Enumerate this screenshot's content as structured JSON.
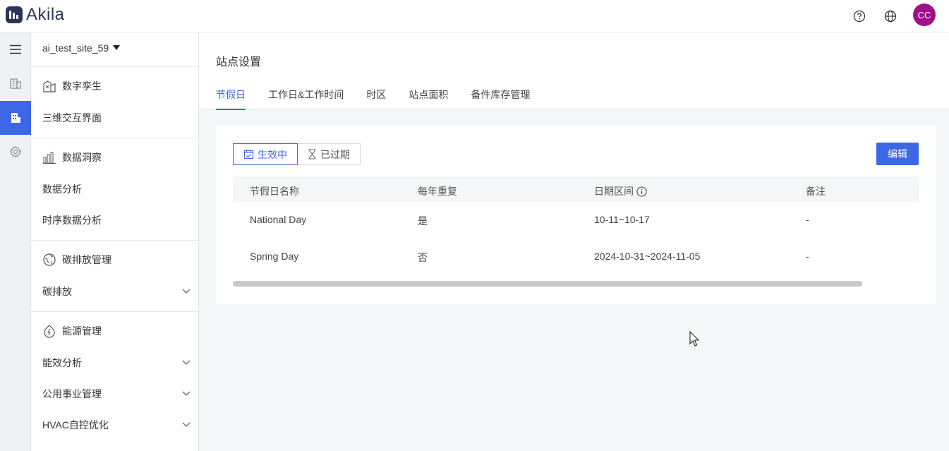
{
  "brand": {
    "name": "Akila"
  },
  "header": {
    "avatar_initials": "CC",
    "help_icon": "question-circle-icon",
    "lang_icon": "globe-icon"
  },
  "rail": {
    "items": [
      "menu-icon",
      "building-icon",
      "site-icon",
      "gear-icon"
    ],
    "active_index": 2
  },
  "sidenav": {
    "site": "ai_test_site_59",
    "groups": [
      {
        "label": "数字孪生",
        "icon": "digital-twin-icon",
        "items": [
          {
            "label": "三维交互界面",
            "expandable": false
          }
        ]
      },
      {
        "label": "数据洞察",
        "icon": "bar-chart-icon",
        "items": [
          {
            "label": "数据分析",
            "expandable": false
          },
          {
            "label": "时序数据分析",
            "expandable": false
          }
        ]
      },
      {
        "label": "碳排放管理",
        "icon": "globe-leaf-icon",
        "items": [
          {
            "label": "碳排放",
            "expandable": true
          }
        ]
      },
      {
        "label": "能源管理",
        "icon": "energy-icon",
        "items": [
          {
            "label": "能效分析",
            "expandable": true
          },
          {
            "label": "公用事业管理",
            "expandable": true
          },
          {
            "label": "HVAC自控优化",
            "expandable": true
          }
        ]
      }
    ]
  },
  "main": {
    "title": "站点设置",
    "tabs": [
      "节假日",
      "工作日&工作时间",
      "时区",
      "站点面积",
      "备件库存管理"
    ],
    "active_tab": 0,
    "filter": {
      "active": "生效中",
      "expired": "已过期"
    },
    "edit_label": "编辑",
    "table": {
      "headers": [
        "节假日名称",
        "每年重复",
        "日期区间",
        "备注"
      ],
      "rows": [
        [
          "National Day",
          "是",
          "10-11~10-17",
          "-"
        ],
        [
          "Spring Day",
          "否",
          "2024-10-31~2024-11-05",
          "-"
        ]
      ]
    }
  },
  "colors": {
    "accent": "#3d67e6",
    "avatar": "#a20d8c",
    "logo": "#2d3557"
  }
}
